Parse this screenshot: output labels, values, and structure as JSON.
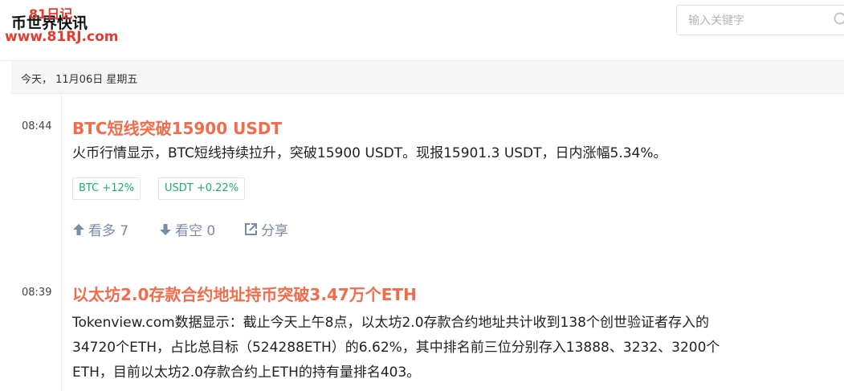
{
  "header": {
    "brand_title": "币世界快讯",
    "watermark_top": "81日记",
    "watermark_url": "www.81RJ.com",
    "search_placeholder": "输入关键字"
  },
  "date_bar": {
    "label": "今天， 11月06日  星期五"
  },
  "news": [
    {
      "time": "08:44",
      "title": "BTC短线突破15900 USDT",
      "body": "火币行情显示，BTC短线持续拉升，突破15900 USDT。现报15901.3 USDT，日内涨幅5.34%。",
      "tags": [
        "BTC +12%",
        "USDT +0.22%"
      ],
      "actions": {
        "bull": "看多 7",
        "bear": "看空 0",
        "share": "分享"
      }
    },
    {
      "time": "08:39",
      "title": "以太坊2.0存款合约地址持币突破3.47万个ETH",
      "body_lines": [
        "Tokenview.com数据显示：截止今天上午8点，以太坊2.0存款合约地址共计收到138个创世验证者存入的",
        "34720个ETH，占比总目标（524288ETH）的6.62%，其中排名前三位分别存入13888、3232、3200个",
        "ETH，目前以太坊2.0存款合约上ETH的持有量排名403。"
      ]
    }
  ],
  "colors": {
    "title": "#f36b4a",
    "tag_text": "#1dae73",
    "action": "#7a8ba6",
    "watermark": "#e83b2e"
  }
}
